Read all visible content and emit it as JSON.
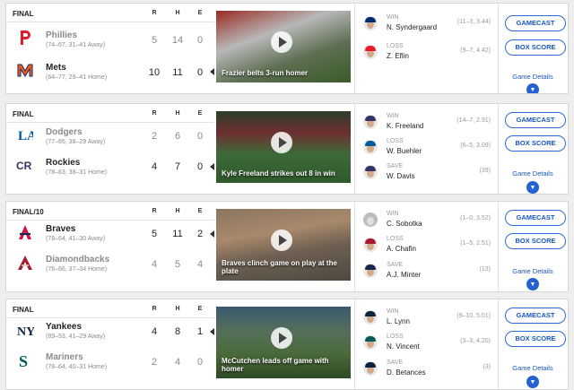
{
  "games": [
    {
      "status": "FINAL",
      "headers": [
        "R",
        "H",
        "E"
      ],
      "teams": [
        {
          "name": "Phillies",
          "record": "(74–67, 31–41 Away)",
          "r": "5",
          "h": "14",
          "e": "0",
          "winner": false,
          "logo": "phillies-logo",
          "color": "#e81828"
        },
        {
          "name": "Mets",
          "record": "(64–77, 29–41 Home)",
          "r": "10",
          "h": "11",
          "e": "0",
          "winner": true,
          "logo": "mets-logo",
          "color": "#ff5910"
        }
      ],
      "video_caption": "Frazier belts 3-run homer",
      "pitchers": [
        {
          "type": "WIN",
          "name": "N. Syndergaard",
          "stat": "(11–3, 3.44)",
          "cap": "#002d72"
        },
        {
          "type": "LOSS",
          "name": "Z. Eflin",
          "stat": "(9–7, 4.42)",
          "cap": "#e81828"
        }
      ],
      "gamecast_label": "GAMECAST",
      "boxscore_label": "BOX SCORE",
      "details_label": "Game Details"
    },
    {
      "status": "FINAL",
      "headers": [
        "R",
        "H",
        "E"
      ],
      "teams": [
        {
          "name": "Dodgers",
          "record": "(77–65, 38–29 Away)",
          "r": "2",
          "h": "6",
          "e": "0",
          "winner": false,
          "logo": "dodgers-logo",
          "color": "#005a9c"
        },
        {
          "name": "Rockies",
          "record": "(78–63, 38–31 Home)",
          "r": "4",
          "h": "7",
          "e": "0",
          "winner": true,
          "logo": "rockies-logo",
          "color": "#333366"
        }
      ],
      "video_caption": "Kyle Freeland strikes out 8 in win",
      "pitchers": [
        {
          "type": "WIN",
          "name": "K. Freeland",
          "stat": "(14–7, 2.91)",
          "cap": "#333366"
        },
        {
          "type": "LOSS",
          "name": "W. Buehler",
          "stat": "(6–5, 3.09)",
          "cap": "#005a9c"
        },
        {
          "type": "SAVE",
          "name": "W. Davis",
          "stat": "(39)",
          "cap": "#333366"
        }
      ],
      "gamecast_label": "GAMECAST",
      "boxscore_label": "BOX SCORE",
      "details_label": "Game Details"
    },
    {
      "status": "FINAL/10",
      "headers": [
        "R",
        "H",
        "E"
      ],
      "teams": [
        {
          "name": "Braves",
          "record": "(78–64, 41–30 Away)",
          "r": "5",
          "h": "11",
          "e": "2",
          "winner": true,
          "logo": "braves-logo",
          "color": "#ce1141"
        },
        {
          "name": "Diamondbacks",
          "record": "(76–66, 37–34 Home)",
          "r": "4",
          "h": "5",
          "e": "4",
          "winner": false,
          "logo": "diamondbacks-logo",
          "color": "#a71930"
        }
      ],
      "video_caption": "Braves clinch game on play at the plate",
      "pitchers": [
        {
          "type": "WIN",
          "name": "C. Sobotka",
          "stat": "(1–0, 3.52)",
          "cap": "",
          "blank": true
        },
        {
          "type": "LOSS",
          "name": "A. Chafin",
          "stat": "(1–5, 2.51)",
          "cap": "#a71930"
        },
        {
          "type": "SAVE",
          "name": "A.J. Minter",
          "stat": "(13)",
          "cap": "#13274f"
        }
      ],
      "gamecast_label": "GAMECAST",
      "boxscore_label": "BOX SCORE",
      "details_label": "Game Details"
    },
    {
      "status": "FINAL",
      "headers": [
        "R",
        "H",
        "E"
      ],
      "teams": [
        {
          "name": "Yankees",
          "record": "(89–53, 41–29 Away)",
          "r": "4",
          "h": "8",
          "e": "1",
          "winner": true,
          "logo": "yankees-logo",
          "color": "#0c2340"
        },
        {
          "name": "Mariners",
          "record": "(78–64, 40–31 Home)",
          "r": "2",
          "h": "4",
          "e": "0",
          "winner": false,
          "logo": "mariners-logo",
          "color": "#005c5c"
        }
      ],
      "video_caption": "McCutchen leads off game with homer",
      "pitchers": [
        {
          "type": "WIN",
          "name": "L. Lynn",
          "stat": "(9–10, 5.01)",
          "cap": "#0c2340"
        },
        {
          "type": "LOSS",
          "name": "N. Vincent",
          "stat": "(3–3, 4.20)",
          "cap": "#005c5c"
        },
        {
          "type": "SAVE",
          "name": "D. Betances",
          "stat": "(3)",
          "cap": "#0c2340"
        }
      ],
      "gamecast_label": "GAMECAST",
      "boxscore_label": "BOX SCORE",
      "details_label": "Game Details"
    }
  ]
}
